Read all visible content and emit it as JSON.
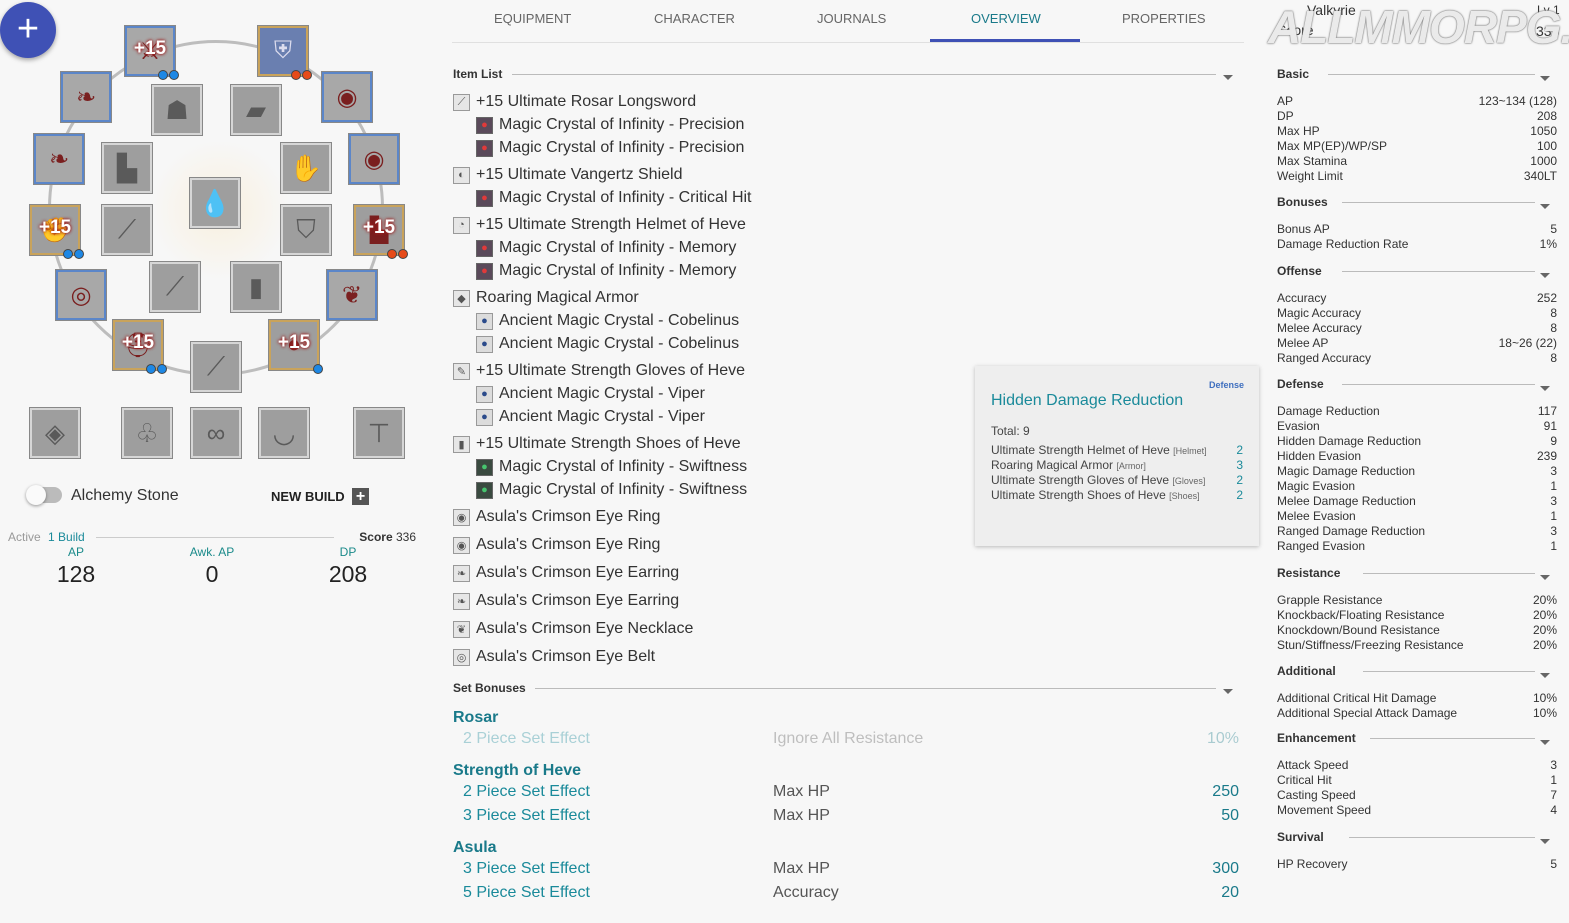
{
  "tabs": [
    {
      "label": "EQUIPMENT"
    },
    {
      "label": "CHARACTER"
    },
    {
      "label": "JOURNALS"
    },
    {
      "label": "OVERVIEW"
    },
    {
      "label": "PROPERTIES"
    }
  ],
  "active_tab": "OVERVIEW",
  "watermark": "ALLMMORPG.RU",
  "character": {
    "name": "Valkyrie",
    "level": "Lv 1",
    "score_label": "Score",
    "score": "336"
  },
  "left": {
    "slots": [
      {
        "enh": "+15"
      },
      {
        "enh": ""
      },
      {
        "enh": "+15"
      },
      {
        "enh": "+15"
      },
      {
        "enh": "+15"
      },
      {
        "enh": "+15"
      }
    ],
    "alchemy_label": "Alchemy Stone",
    "new_build_label": "NEW BUILD",
    "active_label": "Active",
    "build_label": "1 Build",
    "score_label": "Score",
    "score_value": "336",
    "stats": [
      {
        "label": "AP",
        "value": "128"
      },
      {
        "label": "Awk. AP",
        "value": "0"
      },
      {
        "label": "DP",
        "value": "208"
      }
    ]
  },
  "item_list": {
    "title": "Item List",
    "items": [
      {
        "name": "+15 Ultimate Rosar Longsword",
        "crystals": [
          "Magic Crystal of Infinity - Precision",
          "Magic Crystal of Infinity - Precision"
        ]
      },
      {
        "name": "+15 Ultimate Vangertz Shield",
        "crystals": [
          "Magic Crystal of Infinity - Critical Hit"
        ]
      },
      {
        "name": "+15 Ultimate Strength Helmet of Heve",
        "crystals": [
          "Magic Crystal of Infinity - Memory",
          "Magic Crystal of Infinity - Memory"
        ]
      },
      {
        "name": "Roaring Magical Armor",
        "crystals": [
          "Ancient Magic Crystal - Cobelinus",
          "Ancient Magic Crystal - Cobelinus"
        ]
      },
      {
        "name": "+15 Ultimate Strength Gloves of Heve",
        "crystals": [
          "Ancient Magic Crystal - Viper",
          "Ancient Magic Crystal - Viper"
        ]
      },
      {
        "name": "+15 Ultimate Strength Shoes of Heve",
        "crystals": [
          "Magic Crystal of Infinity - Swiftness",
          "Magic Crystal of Infinity - Swiftness"
        ]
      }
    ],
    "accessories": [
      "Asula's Crimson Eye Ring",
      "Asula's Crimson Eye Ring",
      "Asula's Crimson Eye Earring",
      "Asula's Crimson Eye Earring",
      "Asula's Crimson Eye Necklace",
      "Asula's Crimson Eye Belt"
    ]
  },
  "set_bonuses": {
    "title": "Set Bonuses",
    "sets": [
      {
        "name": "Rosar",
        "effects": [
          {
            "piece": "2 Piece Set Effect",
            "stat": "Ignore All Resistance",
            "value": "10%"
          }
        ]
      },
      {
        "name": "Strength of Heve",
        "effects": [
          {
            "piece": "2 Piece Set Effect",
            "stat": "Max HP",
            "value": "250"
          },
          {
            "piece": "3 Piece Set Effect",
            "stat": "Max HP",
            "value": "50"
          }
        ]
      },
      {
        "name": "Asula",
        "effects": [
          {
            "piece": "3 Piece Set Effect",
            "stat": "Max HP",
            "value": "300"
          },
          {
            "piece": "5 Piece Set Effect",
            "stat": "Accuracy",
            "value": "20"
          }
        ]
      }
    ]
  },
  "tooltip": {
    "category": "Defense",
    "title": "Hidden Damage Reduction",
    "total": "Total: 9",
    "rows": [
      {
        "item": "Ultimate Strength Helmet of Heve",
        "slot": "[Helmet]",
        "value": "2"
      },
      {
        "item": "Roaring Magical Armor",
        "slot": "[Armor]",
        "value": "3"
      },
      {
        "item": "Ultimate Strength Gloves of Heve",
        "slot": "[Gloves]",
        "value": "2"
      },
      {
        "item": "Ultimate Strength Shoes of Heve",
        "slot": "[Shoes]",
        "value": "2"
      }
    ]
  },
  "stats_panel": {
    "basic": {
      "title": "Basic",
      "rows": [
        {
          "label": "AP",
          "value": "123~134 (128)"
        },
        {
          "label": "DP",
          "value": "208"
        },
        {
          "label": "Max HP",
          "value": "1050"
        },
        {
          "label": "Max MP(EP)/WP/SP",
          "value": "100"
        },
        {
          "label": "Max Stamina",
          "value": "1000"
        },
        {
          "label": "Weight Limit",
          "value": "340LT"
        }
      ]
    },
    "bonuses": {
      "title": "Bonuses",
      "rows": [
        {
          "label": "Bonus AP",
          "value": "5"
        },
        {
          "label": "Damage Reduction Rate",
          "value": "1%"
        }
      ]
    },
    "offense": {
      "title": "Offense",
      "rows": [
        {
          "label": "Accuracy",
          "value": "252"
        },
        {
          "label": "Magic Accuracy",
          "value": "8"
        },
        {
          "label": "Melee Accuracy",
          "value": "8"
        },
        {
          "label": "Melee AP",
          "value": "18~26 (22)"
        },
        {
          "label": "Ranged Accuracy",
          "value": "8"
        }
      ]
    },
    "defense": {
      "title": "Defense",
      "rows": [
        {
          "label": "Damage Reduction",
          "value": "117"
        },
        {
          "label": "Evasion",
          "value": "91"
        },
        {
          "label": "Hidden Damage Reduction",
          "value": "9"
        },
        {
          "label": "Hidden Evasion",
          "value": "239"
        },
        {
          "label": "Magic Damage Reduction",
          "value": "3"
        },
        {
          "label": "Magic Evasion",
          "value": "1"
        },
        {
          "label": "Melee Damage Reduction",
          "value": "3"
        },
        {
          "label": "Melee Evasion",
          "value": "1"
        },
        {
          "label": "Ranged Damage Reduction",
          "value": "3"
        },
        {
          "label": "Ranged Evasion",
          "value": "1"
        }
      ]
    },
    "resistance": {
      "title": "Resistance",
      "rows": [
        {
          "label": "Grapple Resistance",
          "value": "20%"
        },
        {
          "label": "Knockback/Floating Resistance",
          "value": "20%"
        },
        {
          "label": "Knockdown/Bound Resistance",
          "value": "20%"
        },
        {
          "label": "Stun/Stiffness/Freezing Resistance",
          "value": "20%"
        }
      ]
    },
    "additional": {
      "title": "Additional",
      "rows": [
        {
          "label": "Additional Critical Hit Damage",
          "value": "10%"
        },
        {
          "label": "Additional Special Attack Damage",
          "value": "10%"
        }
      ]
    },
    "enhancement": {
      "title": "Enhancement",
      "rows": [
        {
          "label": "Attack Speed",
          "value": "3"
        },
        {
          "label": "Critical Hit",
          "value": "1"
        },
        {
          "label": "Casting Speed",
          "value": "7"
        },
        {
          "label": "Movement Speed",
          "value": "4"
        }
      ]
    },
    "survival": {
      "title": "Survival",
      "rows": [
        {
          "label": "HP Recovery",
          "value": "5"
        }
      ]
    }
  }
}
